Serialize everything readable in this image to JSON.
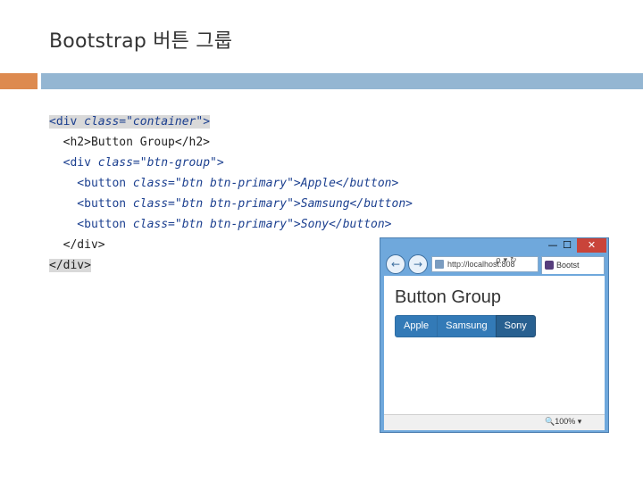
{
  "slide": {
    "title": "Bootstrap 버튼 그룹"
  },
  "code": {
    "line1_open": "<div ",
    "line1_attr": "class=\"container\">",
    "line2": "  <h2>Button Group</h2>",
    "line3_open": "  <div ",
    "line3_attr": "class=\"btn-group\">",
    "line4_open": "    <button ",
    "line4_attr": "class=\"btn btn-primary\">",
    "line4_text": "Apple</button>",
    "line5_open": "    <button ",
    "line5_attr": "class=\"btn btn-primary\">",
    "line5_text": "Samsung</button>",
    "line6_open": "    <button ",
    "line6_attr": "class=\"btn btn-primary\">",
    "line6_text": "Sony</button>",
    "line7": "  </div>",
    "line8": "</div>"
  },
  "browser": {
    "minimize": "—",
    "maximize": "☐",
    "close": "✕",
    "back": "←",
    "forward": "→",
    "address": "http://localhost:808",
    "address_tools": "ρ ▾ ↻",
    "tab_label": "Bootst",
    "heading": "Button Group",
    "buttons": [
      "Apple",
      "Samsung",
      "Sony"
    ],
    "zoom": "🔍100%  ▾"
  },
  "colors": {
    "accent_orange": "#dd8a4f",
    "accent_blue": "#94b6d2",
    "btn_primary": "#337ab7"
  }
}
